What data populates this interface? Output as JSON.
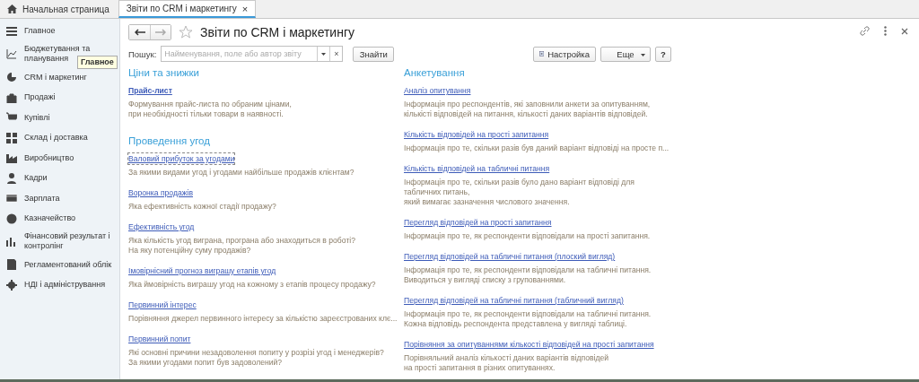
{
  "tabs": [
    {
      "label": "Начальная страница",
      "kind": "home",
      "selected": false
    },
    {
      "label": "Звіти по CRM і маркетингу",
      "kind": "doc",
      "selected": true
    }
  ],
  "tab_close": "×",
  "sidebar": {
    "items": [
      {
        "label": "Главное"
      },
      {
        "label": "Бюджетування та планування"
      },
      {
        "label": "CRM і маркетинг"
      },
      {
        "label": "Продажі"
      },
      {
        "label": "Купівлі"
      },
      {
        "label": "Склад і доставка"
      },
      {
        "label": "Виробництво"
      },
      {
        "label": "Кадри"
      },
      {
        "label": "Зарплата"
      },
      {
        "label": "Казначейство"
      },
      {
        "label": "Фінансовий результат і контролінг"
      },
      {
        "label": "Регламентований облік"
      },
      {
        "label": "НДІ і адміністрування"
      }
    ],
    "tooltip": "Главное"
  },
  "form": {
    "title": "Звіти по CRM і маркетингу",
    "search_label": "Пошук:",
    "search_placeholder": "Найменування, поле або автор звіту",
    "clear": "×",
    "find_button": "Знайти",
    "settings_button": "Настройка",
    "more_button": "Еще",
    "help_button": "?",
    "columns": [
      [
        {
          "title": "Ціни та знижки",
          "reports": [
            {
              "title": "Прайс-лист",
              "bold": true,
              "focused": false,
              "lines": [
                "Формування прайс-листа по обраним цінами,",
                "при необхідності тільки товари в наявності."
              ]
            }
          ]
        },
        {
          "title": "Проведення угод",
          "reports": [
            {
              "title": "Валовий прибуток за угодами",
              "bold": false,
              "focused": true,
              "lines": [
                "За якими видами угод і угодами найбільше продажів клієнтам?"
              ]
            },
            {
              "title": "Воронка продажів",
              "bold": false,
              "focused": false,
              "lines": [
                "Яка ефективність кожної стадії продажу?"
              ]
            },
            {
              "title": "Ефективність угод",
              "bold": false,
              "focused": false,
              "lines": [
                "Яка кількість угод виграна, програна або знаходиться в роботі?",
                "На яку потенційну суму продажів?"
              ]
            },
            {
              "title": "Імовірнісний прогноз виграшу етапів угод",
              "bold": false,
              "focused": false,
              "lines": [
                "Яка ймовірність виграшу угод на кожному з етапів процесу продажу?"
              ]
            },
            {
              "title": "Первинний інтерес",
              "bold": false,
              "focused": false,
              "lines": [
                "Порівняння джерел первинного інтересу за кількістю зареєстрованих клє..."
              ]
            },
            {
              "title": "Первинний попит",
              "bold": false,
              "focused": false,
              "lines": [
                "Які основні причини незадоволення попиту у розрізі угод і менеджерів?",
                "За якими угодами попит був задоволений?"
              ]
            }
          ]
        }
      ],
      [
        {
          "title": "Анкетування",
          "reports": [
            {
              "title": "Аналіз опитування",
              "bold": false,
              "focused": false,
              "lines": [
                "Інформація про респондентів, які заповнили анкети за опитуванням,",
                "кількісті відповідей на питання, кількості даних варіантів відповідей."
              ]
            },
            {
              "title": "Кількість відповідей на прості запитання",
              "bold": false,
              "focused": false,
              "lines": [
                "Інформація про те, скільки разів був даний варіант відповіді на просте п..."
              ]
            },
            {
              "title": "Кількість відповідей на табличні питання",
              "bold": false,
              "focused": false,
              "lines": [
                "Інформація про те, скільки разів було дано варіант відповіді для",
                "табличних питань,",
                "який вимагає зазначення числового значення."
              ]
            },
            {
              "title": "Перегляд відповідей на прості запитання",
              "bold": false,
              "focused": false,
              "lines": [
                "Інформація про те, як респонденти відповідали на прості запитання."
              ]
            },
            {
              "title": "Перегляд відповідей на табличні питання (плоский вигляд)",
              "bold": false,
              "focused": false,
              "lines": [
                "Інформація про те, як респонденти відповідали на табличні питання.",
                "Виводиться у вигляді списку з групованнями."
              ]
            },
            {
              "title": "Перегляд відповідей на табличні питання (табличний вигляд)",
              "bold": false,
              "focused": false,
              "lines": [
                "Інформація про те, як респонденти відповідали на табличні питання.",
                "Кожна відповідь респондента представлена у вигляді таблиці."
              ]
            },
            {
              "title": "Порівняння за опитуваннями кількості відповідей на прості запитання",
              "bold": false,
              "focused": false,
              "lines": [
                "Порівняльний аналіз кількості даних варіантів відповідей",
                "на прості запитання в різних опитуваннях."
              ]
            }
          ]
        }
      ]
    ]
  }
}
